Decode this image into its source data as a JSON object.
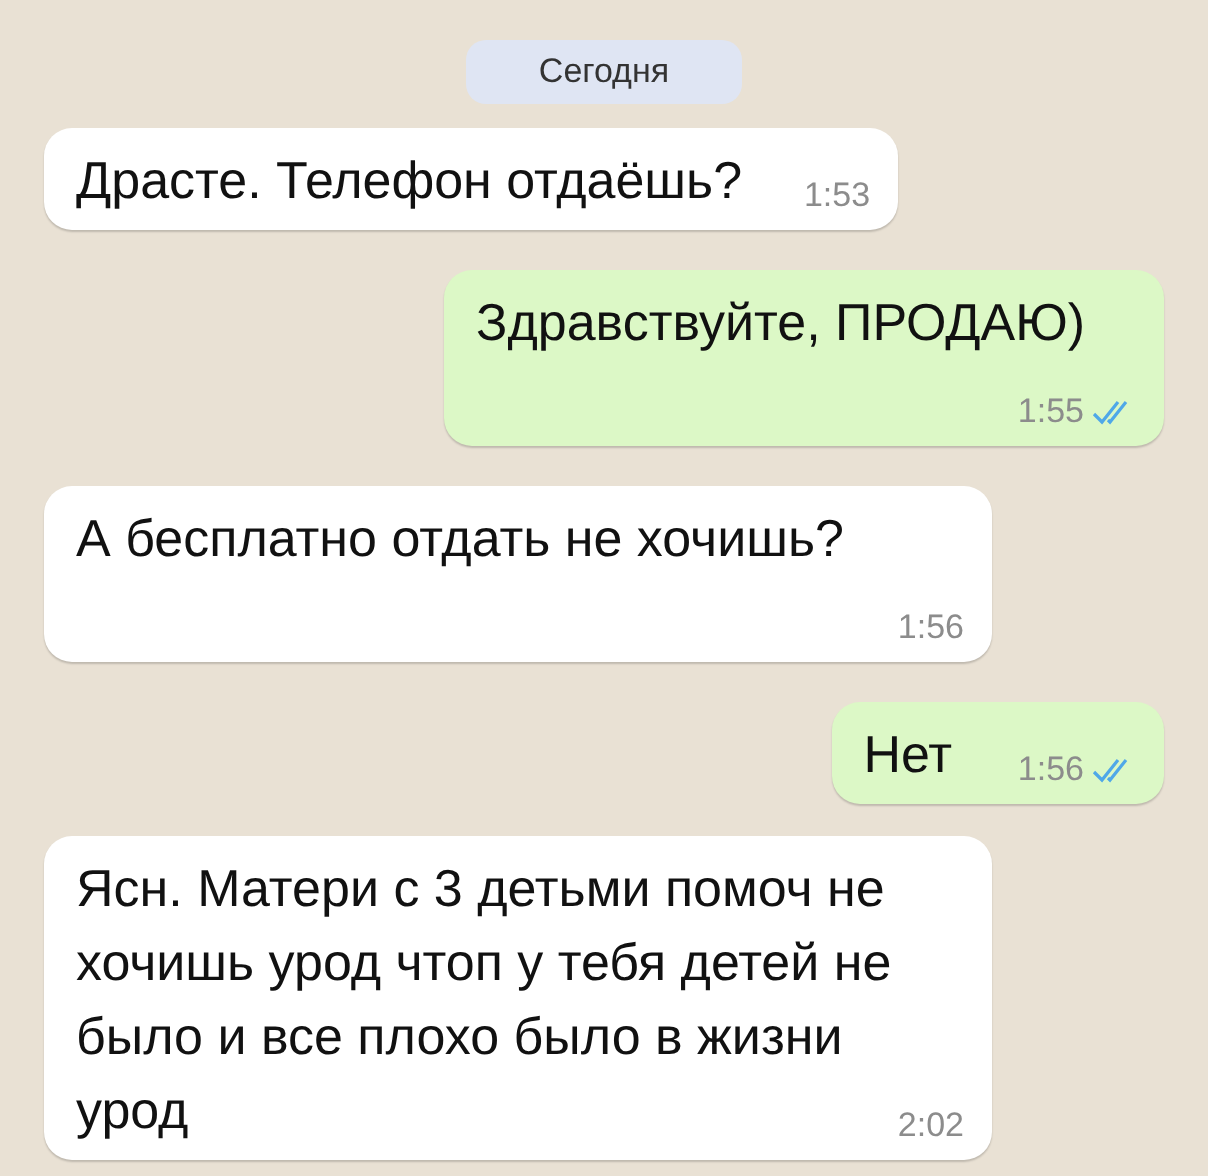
{
  "date_divider": "Сегодня",
  "messages": [
    {
      "outgoing": false,
      "text": "Драсте. Телефон отдаёшь?",
      "time": "1:53"
    },
    {
      "outgoing": true,
      "text": "Здравствуйте, ПРОДАЮ)",
      "time": "1:55",
      "read": true
    },
    {
      "outgoing": false,
      "text": "А бесплатно отдать не хочишь?",
      "time": "1:56"
    },
    {
      "outgoing": true,
      "text": "Нет",
      "time": "1:56",
      "read": true
    },
    {
      "outgoing": false,
      "text": "Ясн. Матери с 3 детьми помоч не хочишь урод чтоп у тебя детей не было и все плохо было в жизни урод",
      "time": "2:02"
    }
  ]
}
